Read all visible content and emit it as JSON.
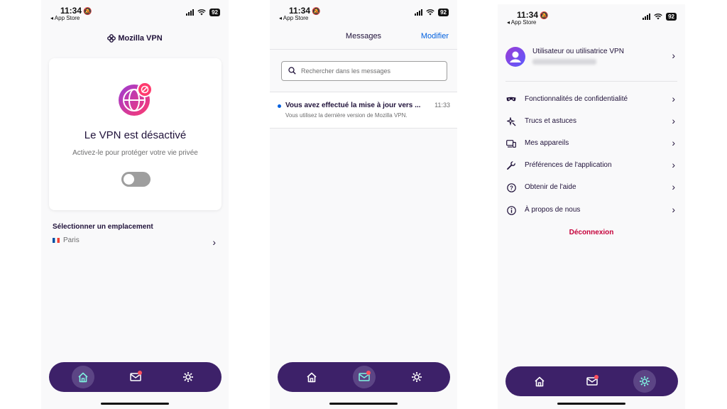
{
  "status": {
    "time": "11:34",
    "back_label": "◂ App Store",
    "battery": "92"
  },
  "home": {
    "brand": "Mozilla VPN",
    "vpn_title": "Le VPN est désactivé",
    "vpn_subtitle": "Activez-le pour protéger votre vie privée",
    "toggle_state": "off",
    "location_title": "Sélectionner un emplacement",
    "location_value": "Paris"
  },
  "messages": {
    "title": "Messages",
    "edit_label": "Modifier",
    "search_placeholder": "Rechercher dans les messages",
    "items": [
      {
        "title": "Vous avez effectué la mise à jour vers ...",
        "time": "11:33",
        "body": "Vous utilisez la dernière version de Mozilla VPN.",
        "unread": true
      }
    ]
  },
  "settings": {
    "user_name": "Utilisateur ou utilisatrice VPN",
    "menu": [
      {
        "label": "Fonctionnalités de confidentialité",
        "icon": "mask-icon"
      },
      {
        "label": "Trucs et astuces",
        "icon": "sparkle-icon"
      },
      {
        "label": "Mes appareils",
        "icon": "devices-icon"
      },
      {
        "label": "Préférences de l'application",
        "icon": "wrench-icon"
      },
      {
        "label": "Obtenir de l'aide",
        "icon": "help-icon"
      },
      {
        "label": "À propos de nous",
        "icon": "info-icon"
      }
    ],
    "logout_label": "Déconnexion"
  },
  "nav": {
    "tabs": [
      "home",
      "messages",
      "settings"
    ]
  },
  "colors": {
    "nav_bg": "#3d2169",
    "accent_blue": "#0060df",
    "logout_red": "#c5003a",
    "badge_red": "#ff4f5e"
  }
}
